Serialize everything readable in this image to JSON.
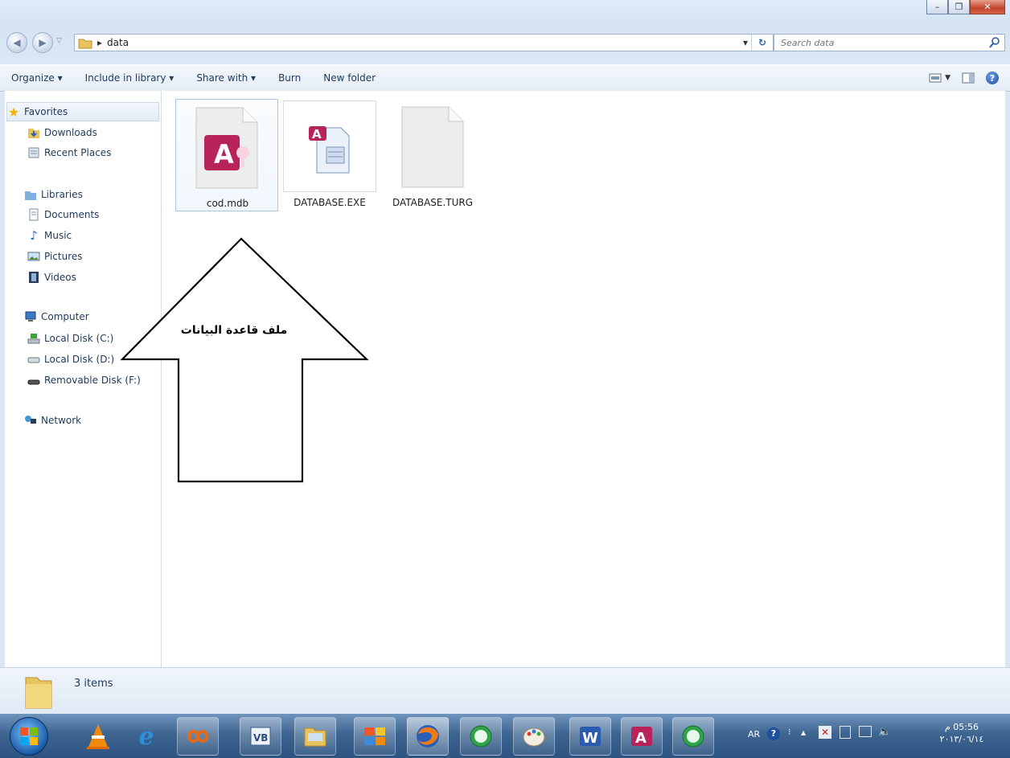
{
  "window": {
    "minimize_glyph": "–",
    "maximize_glyph": "❐",
    "close_glyph": "✕"
  },
  "address": {
    "path_separator": "▸",
    "path": "data",
    "dropdown_glyph": "▾",
    "refresh_glyph": "↻",
    "search_placeholder": "Search data"
  },
  "toolbar": {
    "organize": "Organize ▾",
    "include_in_library": "Include in library ▾",
    "share_with": "Share with ▾",
    "burn": "Burn",
    "new_folder": "New folder",
    "help_glyph": "?"
  },
  "sidebar": {
    "favorites": "Favorites",
    "downloads": "Downloads",
    "recent_places": "Recent Places",
    "libraries": "Libraries",
    "documents": "Documents",
    "music": "Music",
    "pictures": "Pictures",
    "videos": "Videos",
    "computer": "Computer",
    "local_disk_c": "Local Disk (C:)",
    "local_disk_d": "Local Disk (D:)",
    "removable_disk": "Removable Disk (F:)",
    "network": "Network"
  },
  "files": [
    {
      "name": "cod.mdb",
      "icon": "access-database-icon"
    },
    {
      "name": "DATABASE.EXE",
      "icon": "executable-icon"
    },
    {
      "name": "DATABASE.TURG",
      "icon": "generic-file-icon"
    }
  ],
  "annotation": {
    "arrow_label": "ملف قاعدة البيانات"
  },
  "status": {
    "item_count": "3 items"
  },
  "tray": {
    "language": "AR",
    "time": "05:56 م",
    "date": "٢٠١٣/٠٦/١٤"
  }
}
